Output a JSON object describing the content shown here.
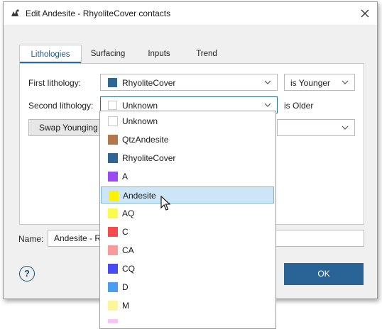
{
  "window": {
    "title": "Edit Andesite - RhyoliteCover contacts"
  },
  "tabs": [
    {
      "label": "Lithologies"
    },
    {
      "label": "Surfacing"
    },
    {
      "label": "Inputs"
    },
    {
      "label": "Trend"
    }
  ],
  "form": {
    "first_label": "First lithology:",
    "first_value": "RhyoliteCover",
    "first_color": "#2f6693",
    "relation_value": "is Younger",
    "second_label": "Second lithology:",
    "second_value": "Unknown",
    "second_suffix": "is Older",
    "swap_button": "Swap Younging",
    "name_label": "Name:",
    "name_value": "Andesite - R"
  },
  "dropdown": {
    "items": [
      {
        "label": "Unknown",
        "color": "#ffffff"
      },
      {
        "label": "QtzAndesite",
        "color": "#b5764a"
      },
      {
        "label": "RhyoliteCover",
        "color": "#2f6693"
      },
      {
        "label": "A",
        "color": "#9b4af0"
      },
      {
        "label": "Andesite",
        "color": "#fff200"
      },
      {
        "label": "AQ",
        "color": "#fbfb4d"
      },
      {
        "label": "C",
        "color": "#f24c4c"
      },
      {
        "label": "CA",
        "color": "#f99a9a"
      },
      {
        "label": "CQ",
        "color": "#4a4af5"
      },
      {
        "label": "D",
        "color": "#4a9ef0"
      },
      {
        "label": "M",
        "color": "#fbf69a"
      }
    ],
    "selected": "Andesite"
  },
  "footer": {
    "help": "?",
    "ok": "OK"
  }
}
